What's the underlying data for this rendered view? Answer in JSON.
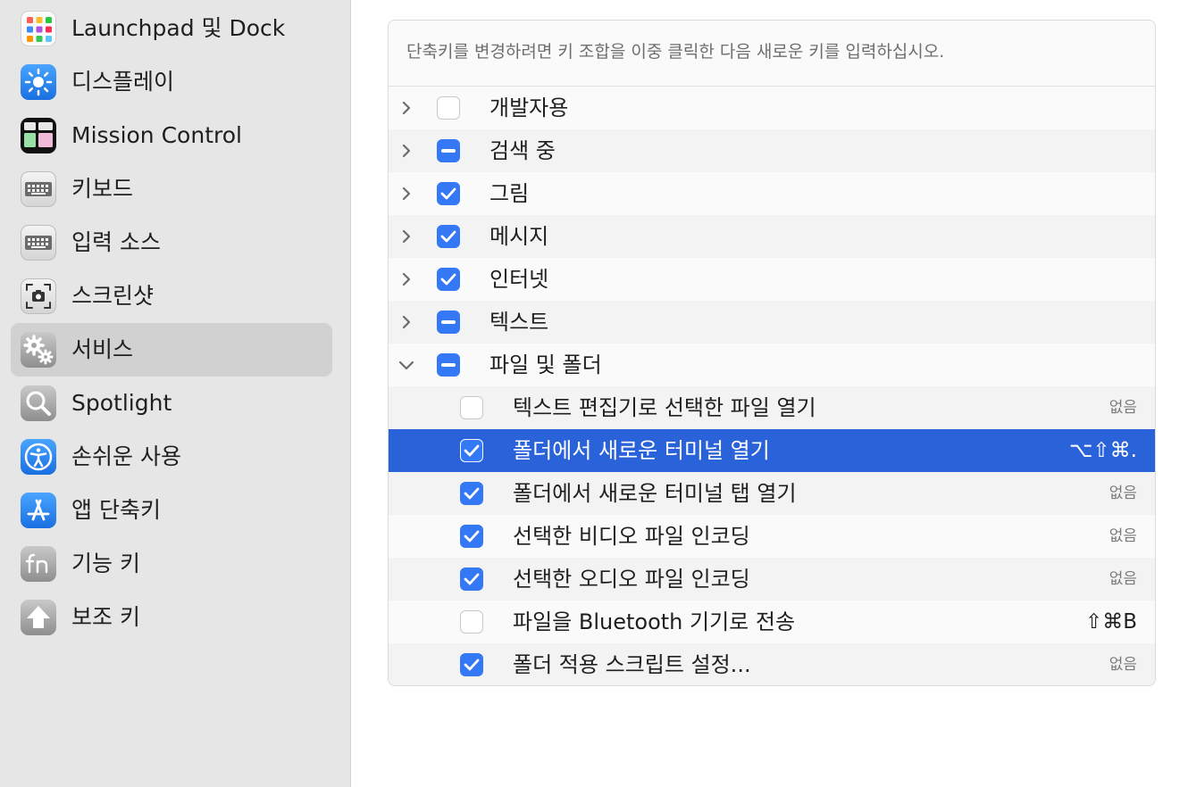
{
  "sidebar": {
    "items": [
      {
        "label": "Launchpad 및 Dock",
        "icon": "launchpad-icon"
      },
      {
        "label": "디스플레이",
        "icon": "display-icon"
      },
      {
        "label": "Mission Control",
        "icon": "mission-control-icon"
      },
      {
        "label": "키보드",
        "icon": "keyboard-icon"
      },
      {
        "label": "입력 소스",
        "icon": "input-sources-icon"
      },
      {
        "label": "스크린샷",
        "icon": "screenshot-icon"
      },
      {
        "label": "서비스",
        "icon": "services-gear-icon",
        "selected": true
      },
      {
        "label": "Spotlight",
        "icon": "spotlight-icon"
      },
      {
        "label": "손쉬운 사용",
        "icon": "accessibility-icon"
      },
      {
        "label": "앱 단축키",
        "icon": "app-shortcuts-icon"
      },
      {
        "label": "기능 키",
        "icon": "function-keys-icon"
      },
      {
        "label": "보조 키",
        "icon": "modifier-keys-icon"
      }
    ]
  },
  "panel": {
    "hint": "단축키를 변경하려면 키 조합을 이중 클릭한 다음 새로운 키를 입력하십시오.",
    "groups": [
      {
        "label": "개발자용",
        "state": "unchecked",
        "expanded": false
      },
      {
        "label": "검색 중",
        "state": "mixed",
        "expanded": false
      },
      {
        "label": "그림",
        "state": "checked",
        "expanded": false
      },
      {
        "label": "메시지",
        "state": "checked",
        "expanded": false
      },
      {
        "label": "인터넷",
        "state": "checked",
        "expanded": false
      },
      {
        "label": "텍스트",
        "state": "mixed",
        "expanded": false
      },
      {
        "label": "파일 및 폴더",
        "state": "mixed",
        "expanded": true
      }
    ],
    "children": [
      {
        "label": "텍스트 편집기로 선택한 파일 열기",
        "checked": false,
        "shortcut": "없음"
      },
      {
        "label": "폴더에서 새로운 터미널 열기",
        "checked": true,
        "shortcut": "⌥⇧⌘.",
        "selected": true
      },
      {
        "label": "폴더에서 새로운 터미널 탭 열기",
        "checked": true,
        "shortcut": "없음"
      },
      {
        "label": "선택한 비디오 파일 인코딩",
        "checked": true,
        "shortcut": "없음"
      },
      {
        "label": "선택한 오디오 파일 인코딩",
        "checked": true,
        "shortcut": "없음"
      },
      {
        "label": "파일을 Bluetooth 기기로 전송",
        "checked": false,
        "shortcut": "⇧⌘B"
      },
      {
        "label": "폴더 적용 스크립트 설정...",
        "checked": true,
        "shortcut": "없음"
      }
    ]
  },
  "colors": {
    "accent": "#3478f6",
    "selection": "#2a62d9",
    "sidebar_bg": "#e6e6e6",
    "sidebar_selected": "#d1d1d1"
  }
}
